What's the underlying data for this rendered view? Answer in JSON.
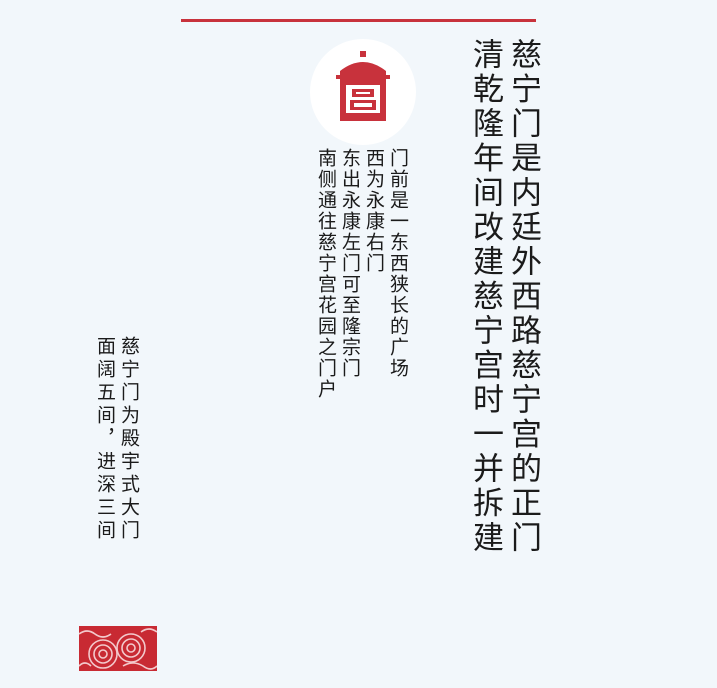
{
  "main": {
    "text": "慈宁门是内廷外西路慈宁宫的正门\n清乾隆年间改建慈宁宫时一并拆建"
  },
  "middle": {
    "text": "门前是一东西狭长的广场\n西为永康右门\n东出永康左门可至隆宗门\n南侧通往慈宁宫花园之门户"
  },
  "left": {
    "text": "慈宁门为殿宇式大门\n面阔五间，进深三间"
  },
  "colors": {
    "accent": "#c8323c",
    "background": "#f2f7fb",
    "text": "#1b1b1b"
  },
  "icons": {
    "emblem": "palace-gate-icon",
    "stamp": "auspicious-cloud-icon"
  }
}
